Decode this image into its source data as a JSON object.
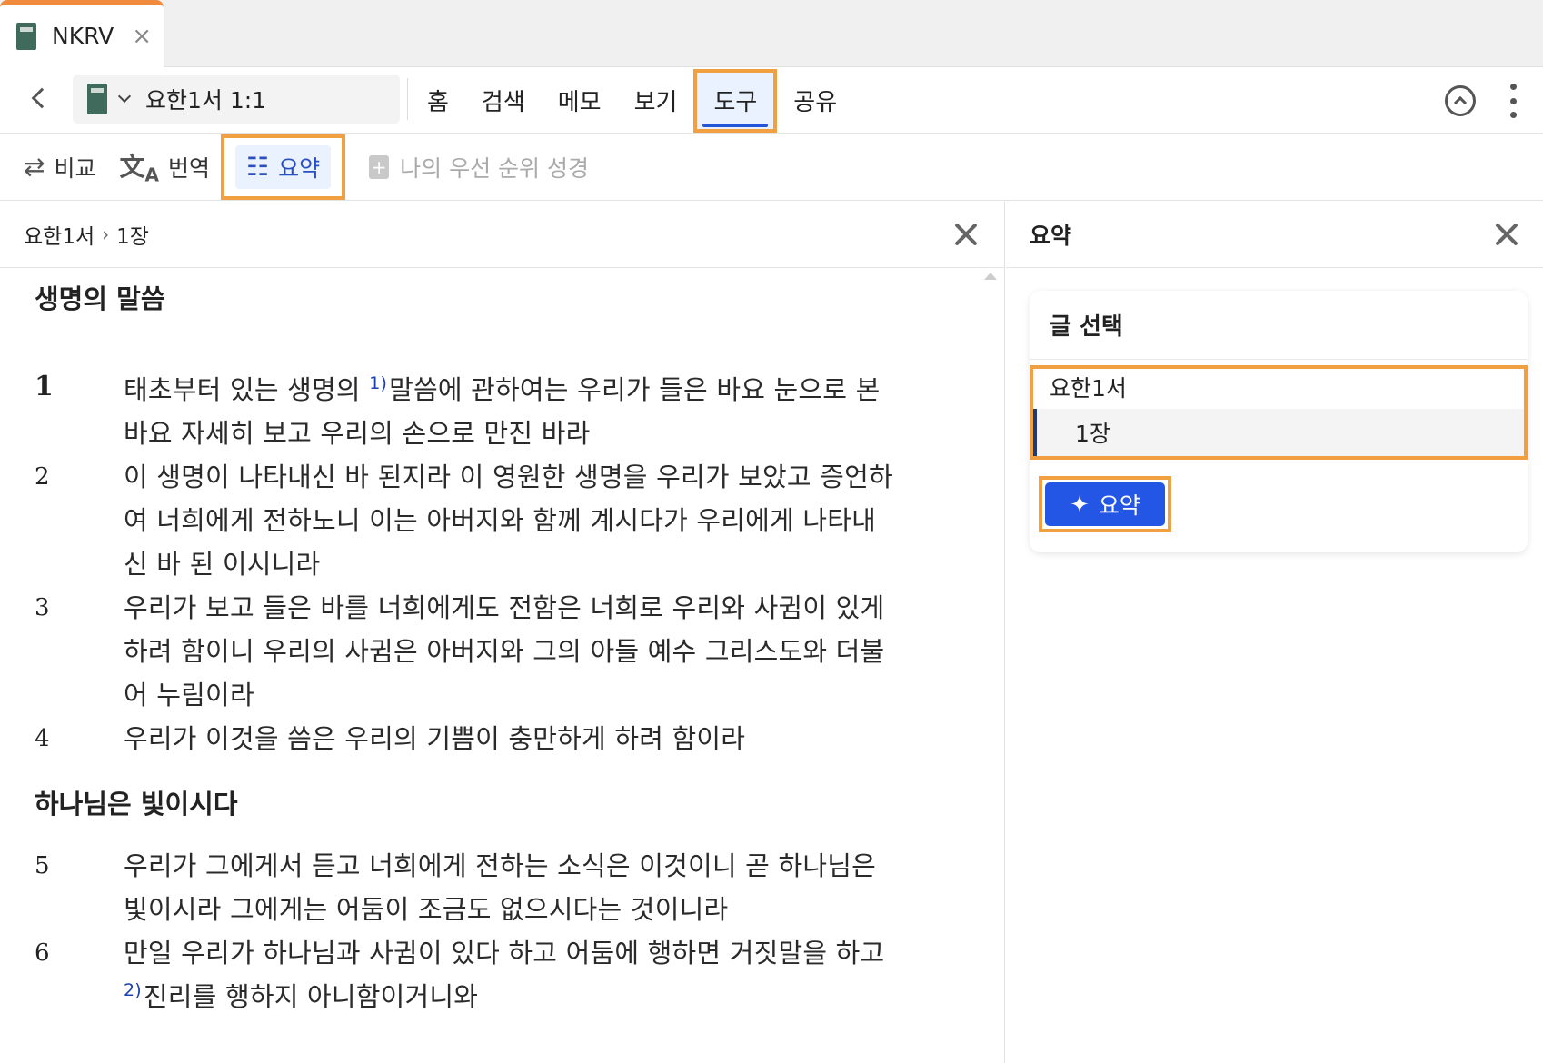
{
  "tab": {
    "title": "NKRV",
    "close_icon": "×"
  },
  "toolbar": {
    "passage_ref": "요한1서 1:1",
    "menu": [
      "홈",
      "검색",
      "메모",
      "보기",
      "도구",
      "공유"
    ],
    "active_menu": "도구"
  },
  "subtoolbar": {
    "compare": "비교",
    "translate": "번역",
    "summary": "요약",
    "priority_bible": "나의 우선 순위 성경"
  },
  "reader": {
    "breadcrumb_book": "요한1서",
    "breadcrumb_sep": "›",
    "breadcrumb_chapter": "1장",
    "section1_title": "생명의 말씀",
    "section2_title": "하나님은 빛이시다",
    "verses": [
      {
        "num": "1",
        "lines": [
          "태초부터 있는 생명의 ",
          "말씀에 관하여는 우리가 들은 바요 눈으로 본",
          "바요 자세히 보고 우리의 손으로 만진 바라"
        ],
        "footnote": "1)"
      },
      {
        "num": "2",
        "lines": [
          "이 생명이 나타내신 바 된지라 이 영원한 생명을 우리가 보았고 증언하",
          "여 너희에게 전하노니 이는 아버지와 함께 계시다가 우리에게 나타내",
          "신 바 된 이시니라"
        ]
      },
      {
        "num": "3",
        "lines": [
          "우리가 보고 들은 바를 너희에게도 전함은 너희로 우리와 사귐이 있게",
          "하려 함이니 우리의 사귐은 아버지와 그의 아들 예수 그리스도와 더불",
          "어 누림이라"
        ]
      },
      {
        "num": "4",
        "lines": [
          "우리가 이것을 씀은 우리의 기쁨이 충만하게 하려 함이라"
        ]
      },
      {
        "num": "5",
        "lines": [
          "우리가 그에게서 듣고 너희에게 전하는 소식은 이것이니 곧 하나님은",
          "빛이시라 그에게는 어둠이 조금도 없으시다는 것이니라"
        ]
      },
      {
        "num": "6",
        "lines": [
          "만일 우리가 하나님과 사귐이 있다 하고 어둠에 행하면 거짓말을 하고",
          "진리를 행하지 아니함이거니와"
        ],
        "footnote": "2)"
      }
    ]
  },
  "summary": {
    "title": "요약",
    "card_title": "글 선택",
    "selected_book": "요한1서",
    "selected_chapter": "1장",
    "button_label": "요약"
  },
  "colors": {
    "highlight": "#f0a040",
    "accent": "#2456e6",
    "tab_accent": "#f08a3c"
  }
}
